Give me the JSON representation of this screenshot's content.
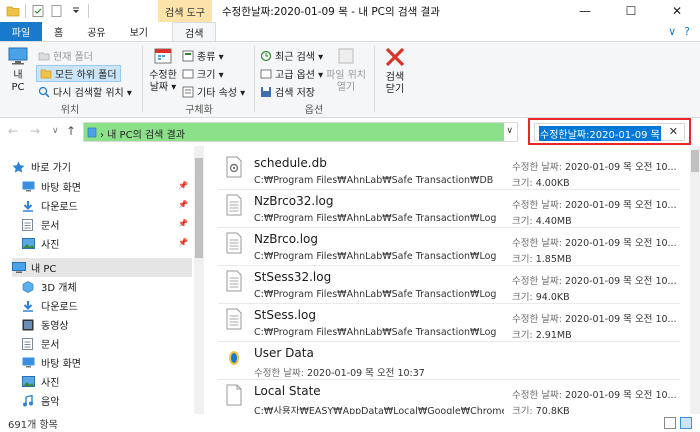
{
  "titlebar": {
    "context_tab": "검색 도구",
    "title": "수정한날짜:2020-01-09 목 - 내 PC의 검색 결과",
    "minimize": "—",
    "maximize": "☐",
    "close": "✕"
  },
  "tabs": {
    "file": "파일",
    "home": "홈",
    "share": "공유",
    "view": "보기",
    "search": "검색",
    "collapse": "∨",
    "help": "?"
  },
  "ribbon": {
    "location": {
      "pc_label": "내\nPC",
      "current_folder": "현재 폴더",
      "all_subfolders": "모든 하위 폴더",
      "search_again": "다시 검색할 위치 ▾",
      "group_label": "위치"
    },
    "refine": {
      "date_modified": "수정한\n날짜 ▾",
      "kind": "종류 ▾",
      "size": "크기 ▾",
      "other_props": "기타 속성 ▾",
      "group_label": "구체화"
    },
    "options": {
      "recent_searches": "최근 검색 ▾",
      "advanced_options": "고급 옵션 ▾",
      "save_search": "검색 저장",
      "open_file_location": "파일 위치\n열기",
      "group_label": "옵션"
    },
    "close_search": "검색\n닫기"
  },
  "navbar": {
    "back": "←",
    "forward": "→",
    "recent": "∨",
    "up": "↑",
    "address_text": "› 내 PC의 검색 결과",
    "address_dropdown": "∨",
    "search_value": "수정한날짜:2020-01-09 목",
    "search_clear": "✕"
  },
  "navpane": {
    "items": [
      {
        "label": "바로 가기",
        "icon": "star-icon",
        "pinned": false
      },
      {
        "label": "바탕 화면",
        "icon": "desktop-icon",
        "pinned": true
      },
      {
        "label": "다운로드",
        "icon": "download-icon",
        "pinned": true
      },
      {
        "label": "문서",
        "icon": "documents-icon",
        "pinned": true
      },
      {
        "label": "사진",
        "icon": "pictures-icon",
        "pinned": true
      },
      {
        "label": "내 PC",
        "icon": "pc-icon",
        "pinned": false
      },
      {
        "label": "3D 개체",
        "icon": "3d-objects-icon",
        "pinned": false
      },
      {
        "label": "다운로드",
        "icon": "download-icon",
        "pinned": false
      },
      {
        "label": "동영상",
        "icon": "videos-icon",
        "pinned": false
      },
      {
        "label": "문서",
        "icon": "documents-icon",
        "pinned": false
      },
      {
        "label": "바탕 화면",
        "icon": "desktop-icon",
        "pinned": false
      },
      {
        "label": "사진",
        "icon": "pictures-icon",
        "pinned": false
      },
      {
        "label": "음악",
        "icon": "music-icon",
        "pinned": false
      }
    ]
  },
  "results": [
    {
      "name": "schedule.db",
      "path": "C:₩Program Files₩AhnLab₩Safe Transaction₩DB",
      "mod_label": "수정한 날짜:",
      "mod_value": "2020-01-09 목 오전 10...",
      "size_label": "크기:",
      "size_value": "4.00KB",
      "icon": "database-file-icon"
    },
    {
      "name": "NzBrco32.log",
      "path": "C:₩Program Files₩AhnLab₩Safe Transaction₩Log",
      "mod_label": "수정한 날짜:",
      "mod_value": "2020-01-09 목 오전 10...",
      "size_label": "크기:",
      "size_value": "4.40MB",
      "icon": "text-file-icon"
    },
    {
      "name": "NzBrco.log",
      "path": "C:₩Program Files₩AhnLab₩Safe Transaction₩Log",
      "mod_label": "수정한 날짜:",
      "mod_value": "2020-01-09 목 오전 10...",
      "size_label": "크기:",
      "size_value": "1.85MB",
      "icon": "text-file-icon"
    },
    {
      "name": "StSess32.log",
      "path": "C:₩Program Files₩AhnLab₩Safe Transaction₩Log",
      "mod_label": "수정한 날짜:",
      "mod_value": "2020-01-09 목 오전 10...",
      "size_label": "크기:",
      "size_value": "94.0KB",
      "icon": "text-file-icon"
    },
    {
      "name": "StSess.log",
      "path": "C:₩Program Files₩AhnLab₩Safe Transaction₩Log",
      "mod_label": "수정한 날짜:",
      "mod_value": "2020-01-09 목 오전 10...",
      "size_label": "크기:",
      "size_value": "2.91MB",
      "icon": "text-file-icon"
    },
    {
      "name": "User Data",
      "path": "",
      "mod_label": "수정한 날짜:",
      "mod_value": "2020-01-09 목 오전 10:37",
      "size_label": "",
      "size_value": "",
      "icon": "folder-shortcut-icon"
    },
    {
      "name": "Local State",
      "path": "C:₩사용자₩EASY₩AppData₩Local₩Google₩Chrome₩Us...",
      "mod_label": "수정한 날짜:",
      "mod_value": "2020-01-09 목 오전 10...",
      "size_label": "크기:",
      "size_value": "70.8KB",
      "icon": "file-icon"
    }
  ],
  "status": {
    "count": "691개 항목"
  },
  "colors": {
    "file_tab": "#1979ca",
    "context_tab": "#fbe3a9",
    "address_progress": "#8ce08a",
    "search_highlight_border": "#e8272a",
    "selection": "#0078d7"
  }
}
